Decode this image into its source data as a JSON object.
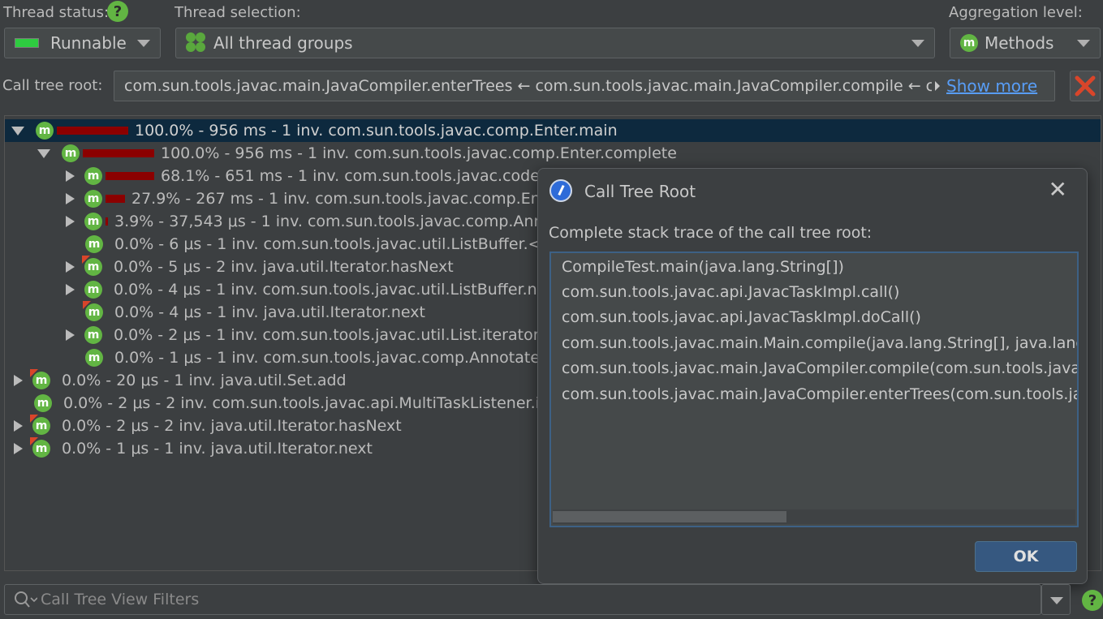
{
  "toolbar": {
    "thread_status_label": "Thread status:",
    "thread_status_value": "Runnable",
    "thread_selection_label": "Thread selection:",
    "thread_selection_value": "All thread groups",
    "aggregation_label": "Aggregation level:",
    "aggregation_value": "Methods",
    "help_glyph": "?"
  },
  "root": {
    "label": "Call tree root:",
    "value": "com.sun.tools.javac.main.JavaCompiler.enterTrees ← com.sun.tools.javac.main.JavaCompiler.compile ← com",
    "show_more": "Show more"
  },
  "tree": {
    "rows": [
      {
        "text": "100.0% - 956 ms - 1 inv. com.sun.tools.javac.comp.Enter.main"
      },
      {
        "text": "100.0% - 956 ms - 1 inv. com.sun.tools.javac.comp.Enter.complete"
      },
      {
        "text": "68.1% - 651 ms - 1 inv. com.sun.tools.javac.code.S"
      },
      {
        "text": "27.9% - 267 ms - 1 inv. com.sun.tools.javac.comp.Ente"
      },
      {
        "text": "3.9% - 37,543 μs - 1 inv. com.sun.tools.javac.comp.Anno"
      },
      {
        "text": "0.0% - 6 μs - 1 inv. com.sun.tools.javac.util.ListBuffer.<in"
      },
      {
        "text": "0.0% - 5 μs - 2 inv. java.util.Iterator.hasNext"
      },
      {
        "text": "0.0% - 4 μs - 1 inv. com.sun.tools.javac.util.ListBuffer.nex"
      },
      {
        "text": "0.0% - 4 μs - 1 inv. java.util.Iterator.next"
      },
      {
        "text": "0.0% - 2 μs - 1 inv. com.sun.tools.javac.util.List.iterator"
      },
      {
        "text": "0.0% - 1 μs - 1 inv. com.sun.tools.javac.comp.Annotate.e"
      },
      {
        "text": "0.0% - 20 μs - 1 inv. java.util.Set.add"
      },
      {
        "text": "0.0% - 2 μs - 2 inv. com.sun.tools.javac.api.MultiTaskListener.isE"
      },
      {
        "text": "0.0% - 2 μs - 2 inv. java.util.Iterator.hasNext"
      },
      {
        "text": "0.0% - 1 μs - 1 inv. java.util.Iterator.next"
      }
    ]
  },
  "dialog": {
    "title": "Call Tree Root",
    "close_glyph": "✕",
    "description": "Complete stack trace of the call tree root:",
    "trace": [
      "CompileTest.main(java.lang.String[])",
      "com.sun.tools.javac.api.JavacTaskImpl.call()",
      "com.sun.tools.javac.api.JavacTaskImpl.doCall()",
      "com.sun.tools.javac.main.Main.compile(java.lang.String[], java.lang.St",
      "com.sun.tools.javac.main.JavaCompiler.compile(com.sun.tools.javac.u",
      "com.sun.tools.javac.main.JavaCompiler.enterTrees(com.sun.tools.java"
    ],
    "ok_label": "OK"
  },
  "filter": {
    "placeholder": "Call Tree View Filters",
    "help_glyph": "?"
  },
  "icons": {
    "method_badge": "m",
    "status_color": "#2ecc40",
    "accent": "#589df6",
    "bar_color": "#8b0000"
  }
}
